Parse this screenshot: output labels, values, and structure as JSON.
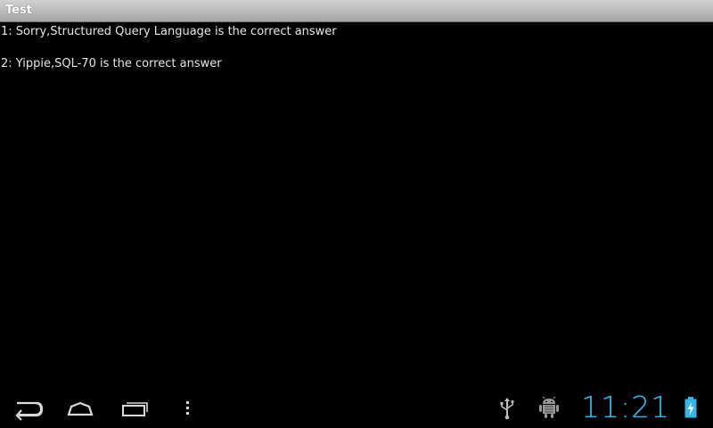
{
  "app": {
    "title": "Test"
  },
  "content": {
    "lines": [
      "1: Sorry,Structured Query Language is the correct answer",
      "2: Yippie,SQL-70 is the correct answer"
    ]
  },
  "status_bar": {
    "time": "11:21",
    "accent_color": "#33b5e5",
    "icons": [
      "usb-icon",
      "android-debug-icon",
      "battery-charging-icon"
    ]
  },
  "nav_bar": {
    "buttons": [
      "back-icon",
      "home-icon",
      "recent-apps-icon",
      "overflow-menu-icon"
    ]
  }
}
